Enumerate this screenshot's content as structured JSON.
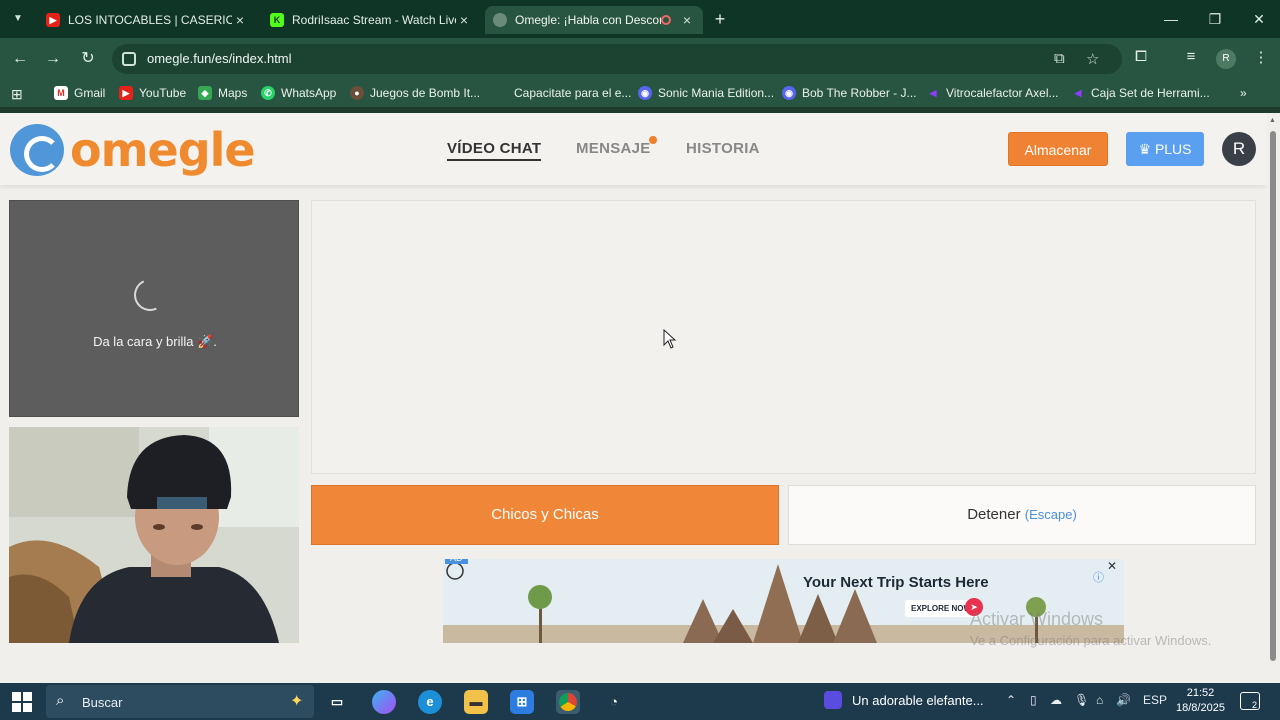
{
  "browser": {
    "tabs": [
      {
        "title": "LOS INTOCABLES | CASERIO TV",
        "favicon": "youtube-icon"
      },
      {
        "title": "RodriIsaac Stream - Watch Live",
        "favicon": "kick-icon"
      },
      {
        "title": "Omegle: ¡Habla con Descon",
        "favicon": "omegle-icon"
      }
    ],
    "url": "omegle.fun/es/index.html",
    "profile_initial": "R",
    "bookmarks": [
      {
        "label": "Gmail",
        "icon": "gmail-icon"
      },
      {
        "label": "YouTube",
        "icon": "youtube-icon"
      },
      {
        "label": "Maps",
        "icon": "maps-icon"
      },
      {
        "label": "WhatsApp",
        "icon": "whatsapp-icon"
      },
      {
        "label": "Juegos de Bomb It...",
        "icon": "game-icon"
      },
      {
        "label": "Capacitate para el e...",
        "icon": "none"
      },
      {
        "label": "Sonic Mania Edition...",
        "icon": "discord-icon"
      },
      {
        "label": "Bob The Robber - J...",
        "icon": "discord-icon"
      },
      {
        "label": "Vitrocalefactor Axel...",
        "icon": "store-icon"
      },
      {
        "label": "Caja Set de Herrami...",
        "icon": "store-icon"
      }
    ],
    "colors": {
      "frame": "#0f3527",
      "toolbar": "#285541"
    }
  },
  "site": {
    "logo_text": "omegle",
    "nav": {
      "video_chat": "VÍDEO CHAT",
      "message": "MENSAJE",
      "history": "HISTORIA"
    },
    "store_label": "Almacenar",
    "plus_label": "PLUS",
    "avatar_initial": "R",
    "remote_caption": "Da la cara y brilla 🚀.",
    "start_label": "Chicos y Chicas",
    "stop_label": "Detener",
    "stop_hint": "(Escape)",
    "colors": {
      "accent": "#ef8638",
      "plus": "#5a9ff0",
      "link": "#4a8fd9"
    }
  },
  "ad": {
    "tag": "AD",
    "headline": "Your Next Trip Starts Here",
    "cta": "EXPLORE NOW!"
  },
  "watermark": {
    "line1": "Activar Windows",
    "line2": "Ve a Configuración para activar Windows."
  },
  "taskbar": {
    "search_placeholder": "Buscar",
    "media_title": "Un adorable elefante...",
    "language": "ESP",
    "time": "21:52",
    "date": "18/8/2025",
    "notifications": "2"
  }
}
